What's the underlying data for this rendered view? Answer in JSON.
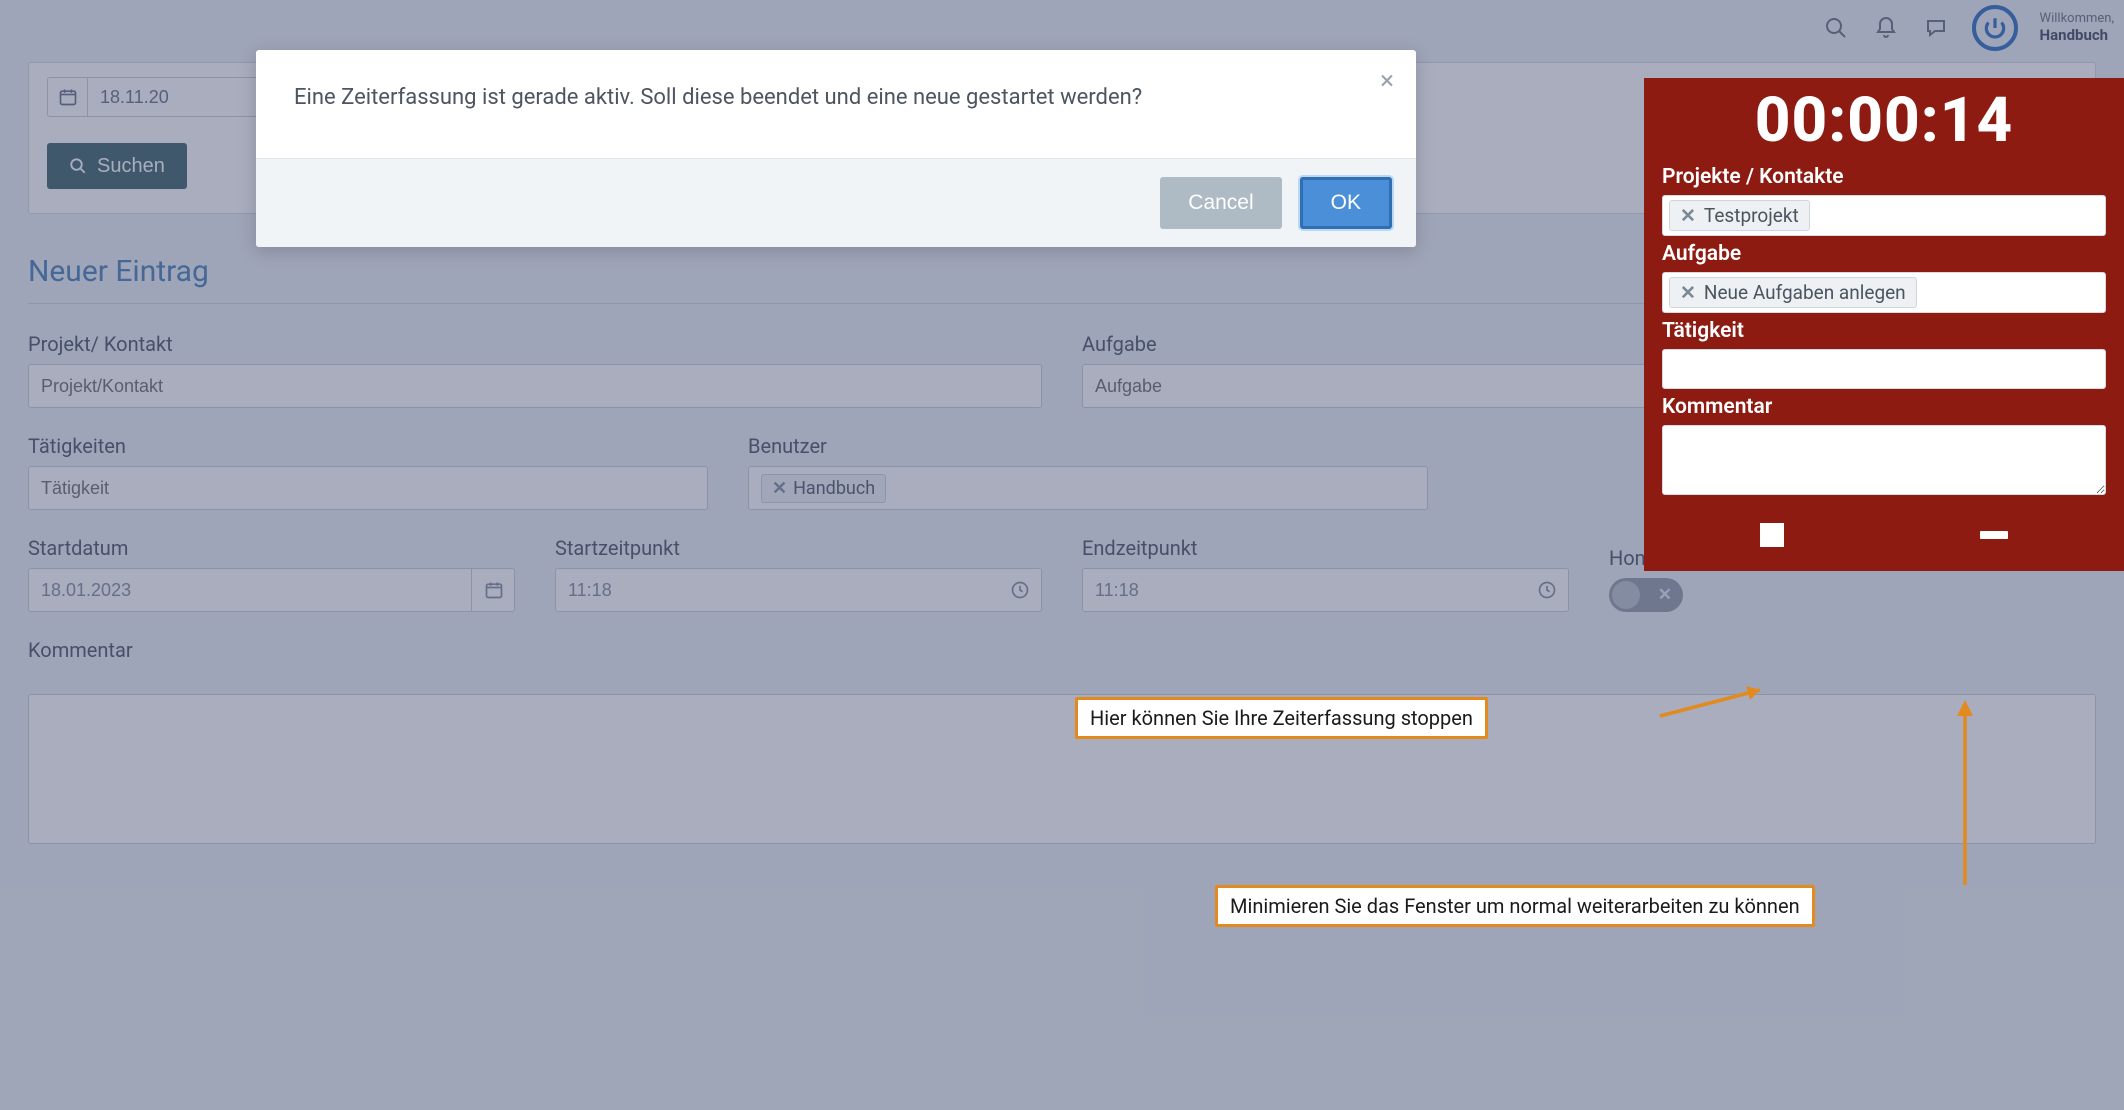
{
  "header": {
    "welcome_label": "Willkommen,",
    "username": "Handbuch"
  },
  "filter": {
    "date_value": "18.11.20",
    "search_label": "Suchen"
  },
  "section_title": "Neuer Eintrag",
  "form": {
    "projekt_label": "Projekt/ Kontakt",
    "projekt_placeholder": "Projekt/Kontakt",
    "aufgabe_label": "Aufgabe",
    "aufgabe_placeholder": "Aufgabe",
    "taetigkeiten_label": "Tätigkeiten",
    "taetigkeiten_placeholder": "Tätigkeit",
    "benutzer_label": "Benutzer",
    "benutzer_tag": "Handbuch",
    "startdatum_label": "Startdatum",
    "startdatum_value": "18.01.2023",
    "startzeit_label": "Startzeitpunkt",
    "startzeit_value": "11:18",
    "endzeit_label": "Endzeitpunkt",
    "endzeit_value": "11:18",
    "homeoffice_label": "Home Office",
    "kommentar_label": "Kommentar"
  },
  "modal": {
    "message": "Eine Zeiterfassung ist gerade aktiv. Soll diese beendet und eine neue gestartet werden?",
    "cancel_label": "Cancel",
    "ok_label": "OK"
  },
  "timer": {
    "clock": "00:00:14",
    "projekte_label": "Projekte / Kontakte",
    "projekt_tag": "Testprojekt",
    "aufgabe_label": "Aufgabe",
    "aufgabe_tag": "Neue Aufgaben anlegen",
    "taetigkeit_label": "Tätigkeit",
    "kommentar_label": "Kommentar"
  },
  "annotations": {
    "stop_hint": "Hier können Sie Ihre Zeiterfassung stoppen",
    "minimize_hint": "Minimieren Sie das Fenster um normal weiterarbeiten zu können"
  }
}
